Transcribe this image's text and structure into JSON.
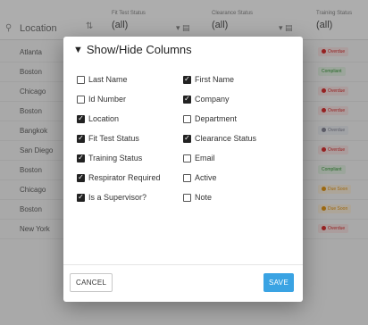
{
  "table": {
    "header": {
      "location_label": "Location",
      "fit_test_label": "Fit Test Status",
      "fit_test_value": "(all)",
      "clearance_label": "Clearance Status",
      "clearance_value": "(all)",
      "training_label": "Training Status",
      "training_value": "(all)"
    },
    "rows": [
      {
        "city": "Atlanta",
        "status": "Overdue"
      },
      {
        "city": "Boston",
        "status": "Compliant"
      },
      {
        "city": "Chicago",
        "status": "Overdue"
      },
      {
        "city": "Boston",
        "status": "Overdue"
      },
      {
        "city": "Bangkok",
        "status": "Overdue"
      },
      {
        "city": "San Diego",
        "status": "Overdue"
      },
      {
        "city": "Boston",
        "status": "Compliant"
      },
      {
        "city": "Chicago",
        "status": "Due Soon"
      },
      {
        "city": "Boston",
        "status": "Due Soon"
      },
      {
        "city": "New York",
        "status": "Overdue"
      }
    ]
  },
  "dialog": {
    "title": "Show/Hide Columns",
    "left_options": [
      {
        "label": "Last Name",
        "checked": false
      },
      {
        "label": "Id Number",
        "checked": false
      },
      {
        "label": "Location",
        "checked": true
      },
      {
        "label": "Fit Test Status",
        "checked": true
      },
      {
        "label": "Training Status",
        "checked": true
      },
      {
        "label": "Respirator Required",
        "checked": true
      },
      {
        "label": "Is a Supervisor?",
        "checked": true
      }
    ],
    "right_options": [
      {
        "label": "First Name",
        "checked": true
      },
      {
        "label": "Company",
        "checked": true
      },
      {
        "label": "Department",
        "checked": false
      },
      {
        "label": "Clearance Status",
        "checked": true
      },
      {
        "label": "Email",
        "checked": false
      },
      {
        "label": "Active",
        "checked": false
      },
      {
        "label": "Note",
        "checked": false
      }
    ],
    "cancel_label": "CANCEL",
    "save_label": "SAVE"
  },
  "colors": {
    "save_button": "#3aa3e3",
    "overdue": "#dd3333",
    "compliant": "#3a9a3a",
    "due_soon": "#e69a1a"
  }
}
